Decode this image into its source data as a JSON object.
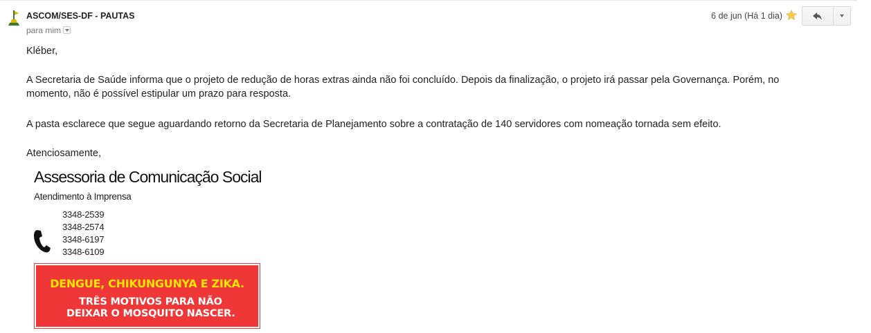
{
  "header": {
    "sender_name": "ASCOM/SES-DF - PAUTAS",
    "recipient_label": "para mim",
    "date": "6 de jun (Há 1 dia)",
    "icons": {
      "sender": "df-flag-icon",
      "star": "star-icon",
      "reply": "reply-icon",
      "more": "chevron-down-icon"
    },
    "star_color": "#f7cb4d"
  },
  "body": {
    "greeting": "Kléber,",
    "paragraph_1": "A Secretaria de Saúde informa que o projeto de redução de horas extras ainda não foi concluído. Depois da finalização, o projeto irá passar pela Governança. Porém, no momento, não é possível estipular um prazo para resposta.",
    "paragraph_2": "A pasta esclarece que segue aguardando retorno da Secretaria de Planejamento sobre a contratação de 140 servidores com nomeação tornada sem efeito.",
    "closing": "Atenciosamente,"
  },
  "signature": {
    "title": "Assessoria de Comunicação Social",
    "subtitle": "Atendimento à Imprensa",
    "phone_icon": "phone-icon",
    "phones": [
      "3348-2539",
      "3348-2574",
      "3348-6197",
      "3348-6109"
    ]
  },
  "banner": {
    "line_1": "DENGUE, CHIKUNGUNYA E ZIKA.",
    "line_2": "TRÊS MOTIVOS PARA NÃO",
    "line_3": "DEIXAR O MOSQUITO NASCER.",
    "background_color": "#ef3737",
    "highlight_color": "#ffe500"
  }
}
